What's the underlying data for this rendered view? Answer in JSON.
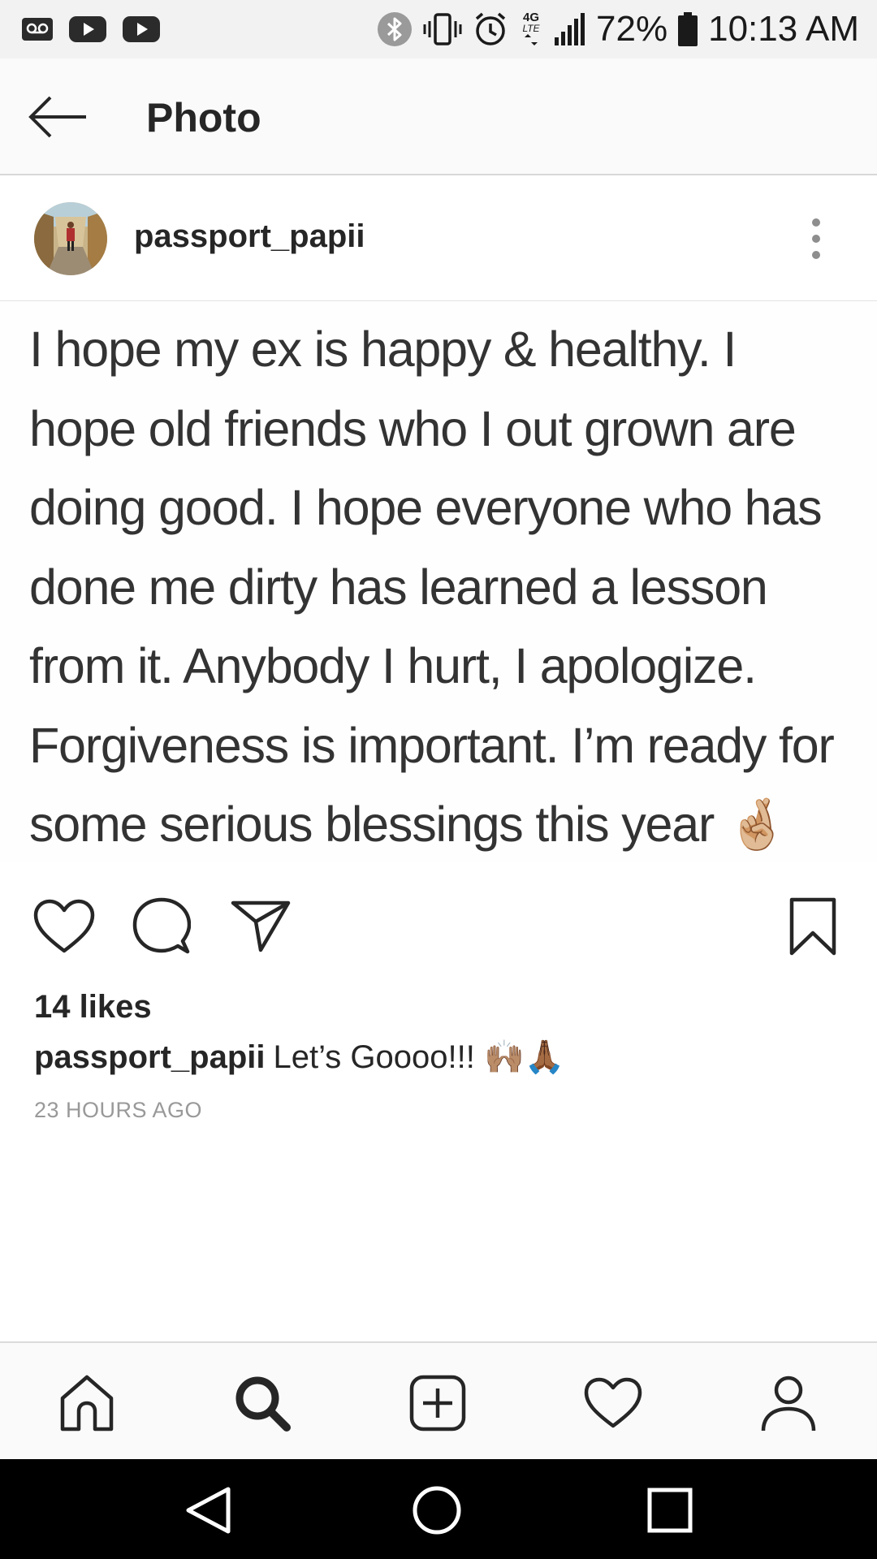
{
  "status_bar": {
    "battery": "72%",
    "time": "10:13 AM",
    "network": "4G LTE",
    "icons": [
      "voicemail-icon",
      "youtube-icon",
      "youtube-icon",
      "bluetooth-icon",
      "vibrate-icon",
      "alarm-icon",
      "lte-icon",
      "signal-icon",
      "battery-icon"
    ]
  },
  "header": {
    "title": "Photo",
    "back_icon": "arrow-left-icon"
  },
  "post": {
    "username": "passport_papii",
    "avatar_icon": "avatar-photo",
    "more_icon": "more-vertical-icon",
    "image_text": "I hope my ex is happy & healthy. I\nhope old friends who I out grown are\ndoing good. I hope everyone who has\ndone me dirty has learned a lesson\nfrom it. Anybody I hurt, I apologize.\nForgiveness is important. I’m ready for\nsome serious blessings this year 🤞🏼",
    "actions": [
      "heart-icon",
      "comment-icon",
      "share-icon",
      "bookmark-icon"
    ],
    "likes": "14 likes",
    "caption_user": "passport_papii",
    "caption_text": "Let’s Goooo!!! 🙌🏽🙏🏾",
    "timestamp": "23 HOURS AGO"
  },
  "bottom_nav": {
    "items": [
      "home-icon",
      "search-icon",
      "add-post-icon",
      "activity-heart-icon",
      "profile-icon"
    ],
    "active": "search-icon"
  },
  "system_nav": {
    "items": [
      "back-triangle-icon",
      "home-circle-icon",
      "recents-square-icon"
    ]
  },
  "colors": {
    "text": "#262626",
    "secondary_text": "#999999",
    "status_bar_bg": "#f2f2f2",
    "header_bg": "#fafafa",
    "system_nav_bg": "#000000"
  }
}
